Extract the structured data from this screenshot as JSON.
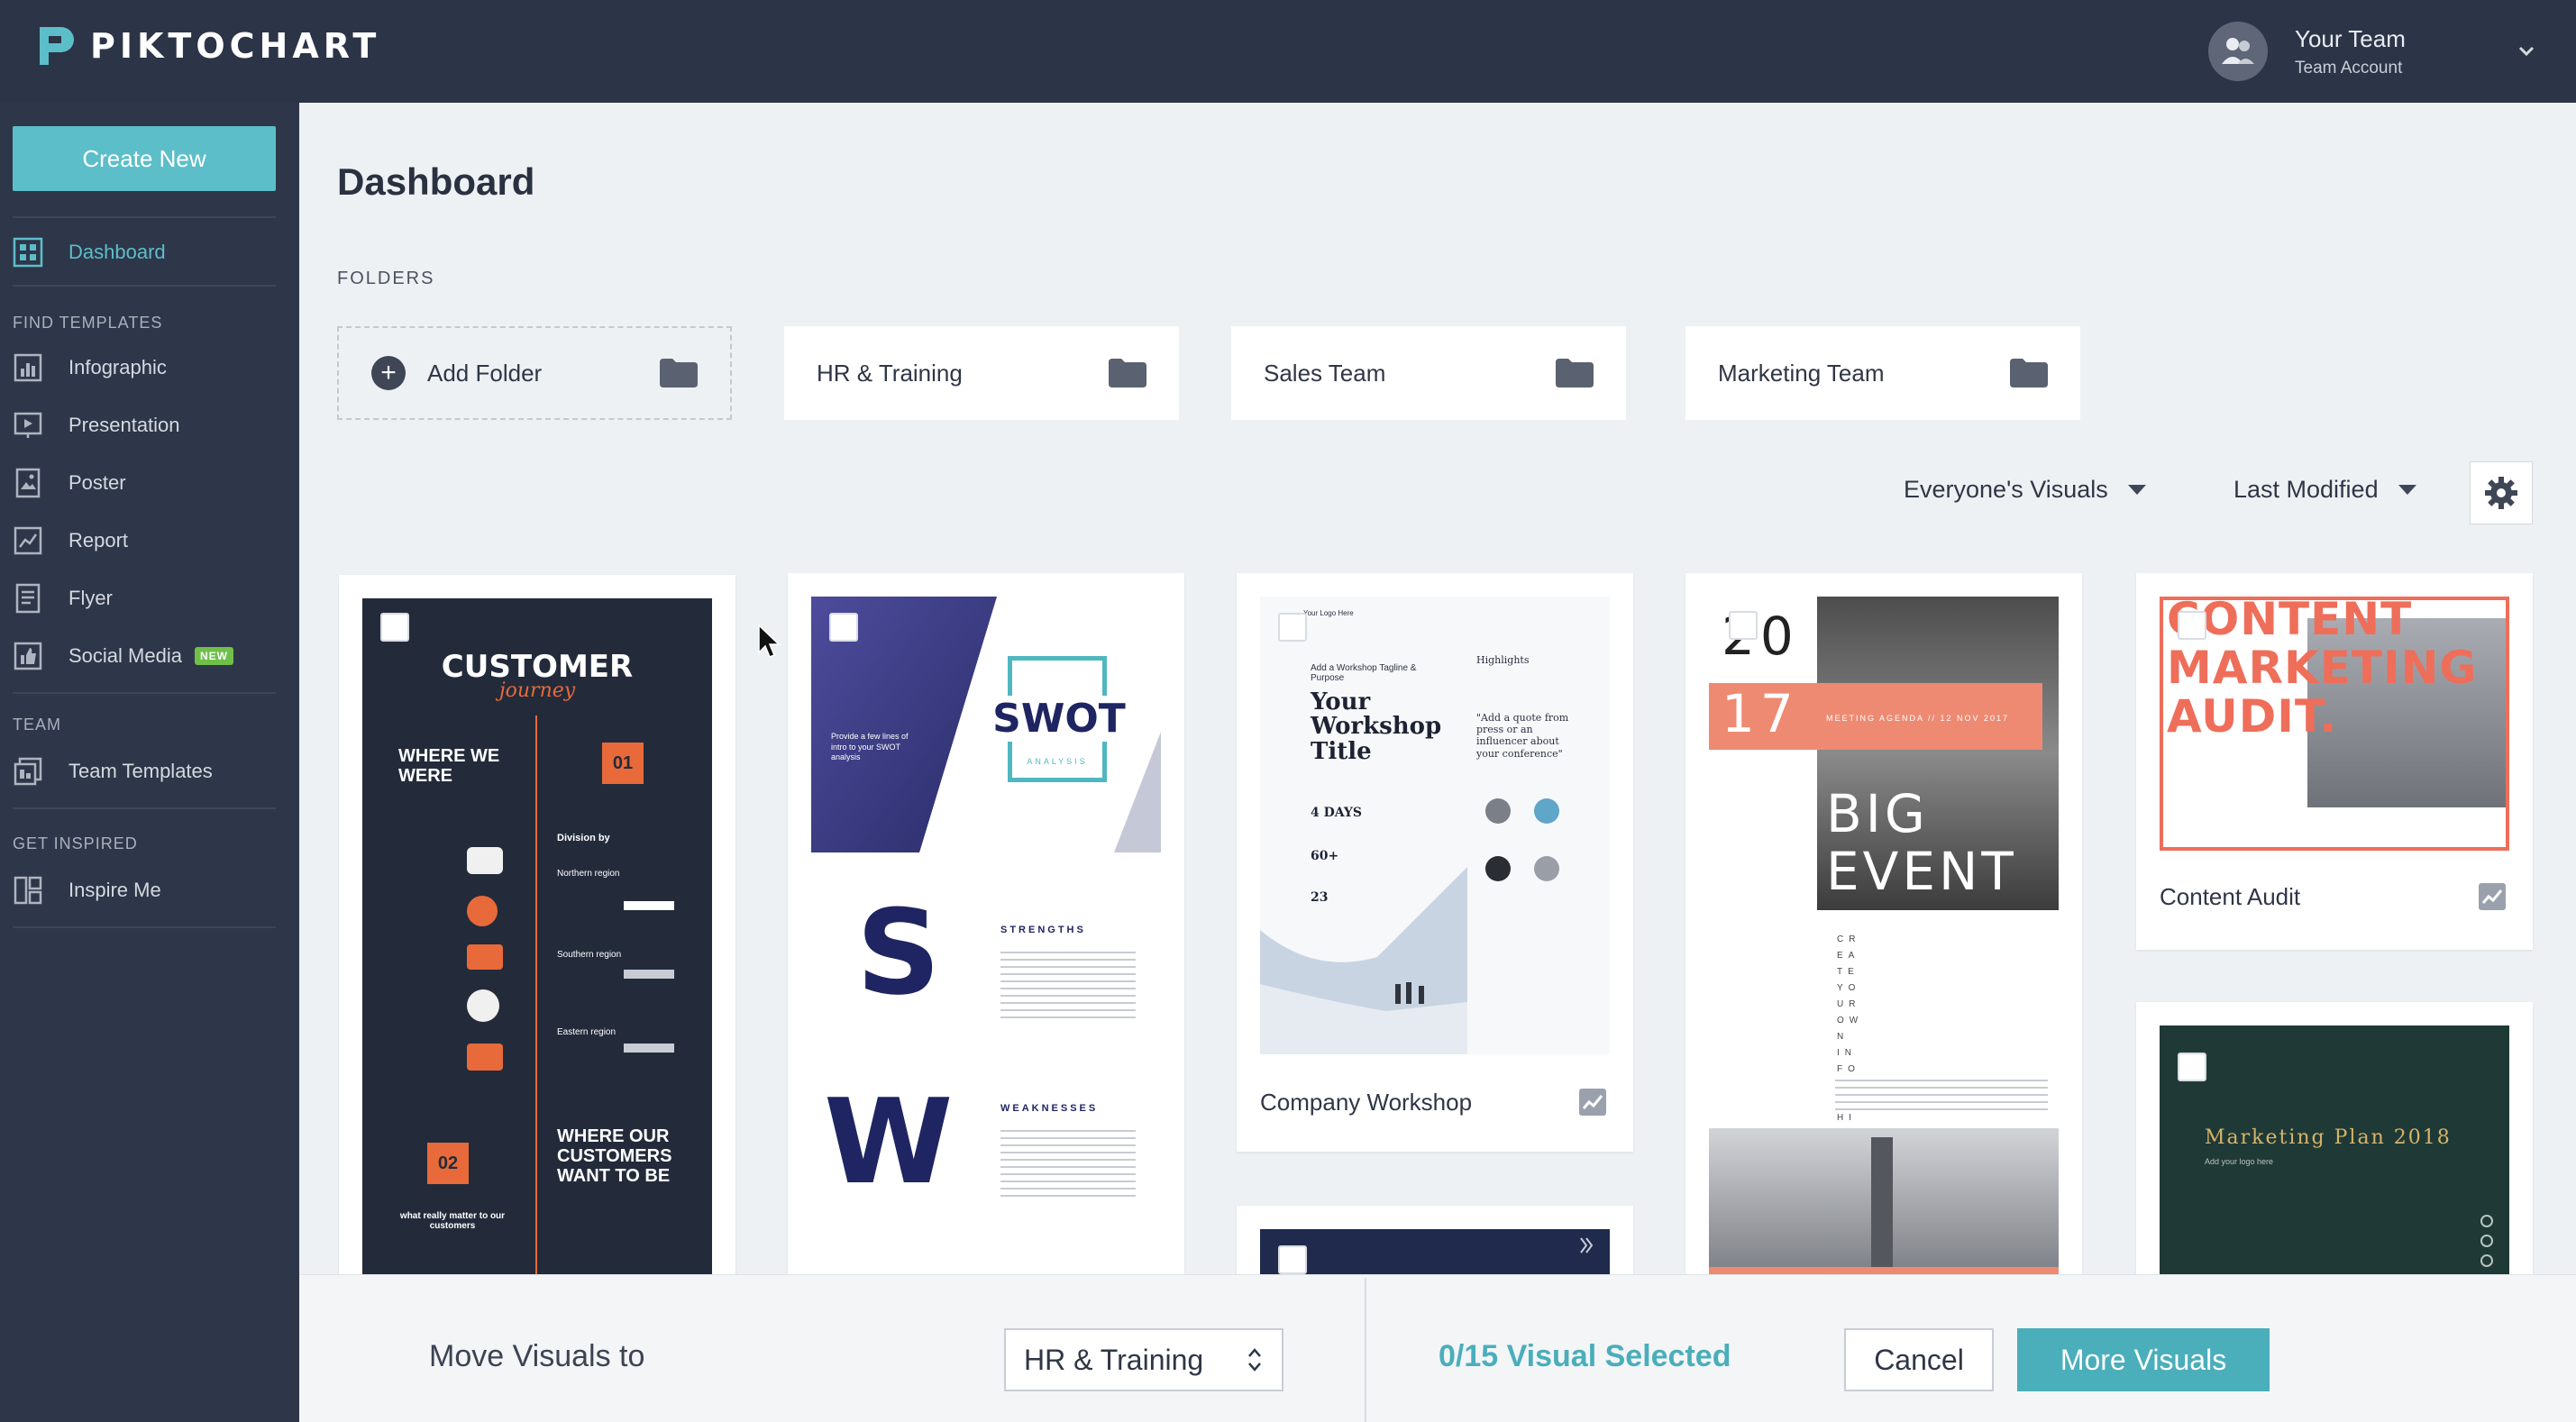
{
  "brand": {
    "name": "PIKTOCHART"
  },
  "user": {
    "name": "Your Team",
    "account": "Team Account"
  },
  "sidebar": {
    "create_label": "Create New",
    "dashboard_label": "Dashboard",
    "find_heading": "FIND TEMPLATES",
    "templates": [
      {
        "label": "Infographic"
      },
      {
        "label": "Presentation"
      },
      {
        "label": "Poster"
      },
      {
        "label": "Report"
      },
      {
        "label": "Flyer"
      },
      {
        "label": "Social Media",
        "badge": "NEW"
      }
    ],
    "team_heading": "TEAM",
    "team_templates_label": "Team Templates",
    "inspired_heading": "GET INSPIRED",
    "inspire_label": "Inspire Me"
  },
  "main": {
    "title": "Dashboard",
    "folders_heading": "FOLDERS",
    "folders": [
      {
        "label": "Add Folder"
      },
      {
        "label": "HR & Training"
      },
      {
        "label": "Sales Team"
      },
      {
        "label": "Marketing Team"
      }
    ],
    "filter_owner": "Everyone's Visuals",
    "filter_sort": "Last Modified"
  },
  "cards": [
    {
      "thumb_text": {
        "title": "CUSTOMER",
        "script": "journey",
        "where": "WHERE WE WERE",
        "num1": "01",
        "division": "Division by",
        "region1": "Northern region",
        "region2": "Southern region",
        "region3": "Eastern region",
        "num2": "02",
        "where_want": "WHERE OUR CUSTOMERS WANT TO BE",
        "matter": "what really matter to our customers"
      }
    },
    {
      "thumb_text": {
        "swot": "SWOT",
        "analysis": "ANALYSIS",
        "intro": "Provide a few lines of intro to your SWOT analysis",
        "s": "S",
        "strengths": "STRENGTHS",
        "w": "W",
        "weaknesses": "WEAKNESSES"
      }
    },
    {
      "title": "Company Workshop",
      "thumb_text": {
        "logo": "Your Logo Here",
        "tagline": "Add a Workshop Tagline & Purpose",
        "headline": "Your Workshop Title",
        "highlights": "Highlights",
        "quote": "\"Add a quote from press or an influencer about your conference\"",
        "days": "4 DAYS",
        "speakers": "60+",
        "sessions": "23"
      }
    },
    {
      "thumb_text": {
        "num_top": "20",
        "num_bottom": "17",
        "meeting": "MEETING AGENDA // 12 NOV 2017",
        "big": "BIG",
        "event": "EVENT",
        "create": "CREATE YOUR OWN INFO GRAPHIC"
      }
    },
    {
      "title": "Content Audit",
      "thumb_text": {
        "line1": "CONTENT",
        "line2": "MARKETING",
        "line3": "AUDIT."
      }
    },
    {
      "thumb_text": {
        "title": "Marketing Plan 2018",
        "sub": "Add your logo here"
      }
    }
  ],
  "bottom": {
    "move_label": "Move Visuals to",
    "move_target": "HR & Training",
    "selected": "0/15 Visual Selected",
    "cancel": "Cancel",
    "more": "More Visuals"
  },
  "colors": {
    "accent": "#4aaebb",
    "sidebar": "#2e3649",
    "topbar": "#2c3447",
    "orange": "#e86a3a",
    "salmon": "#ee8a72"
  }
}
